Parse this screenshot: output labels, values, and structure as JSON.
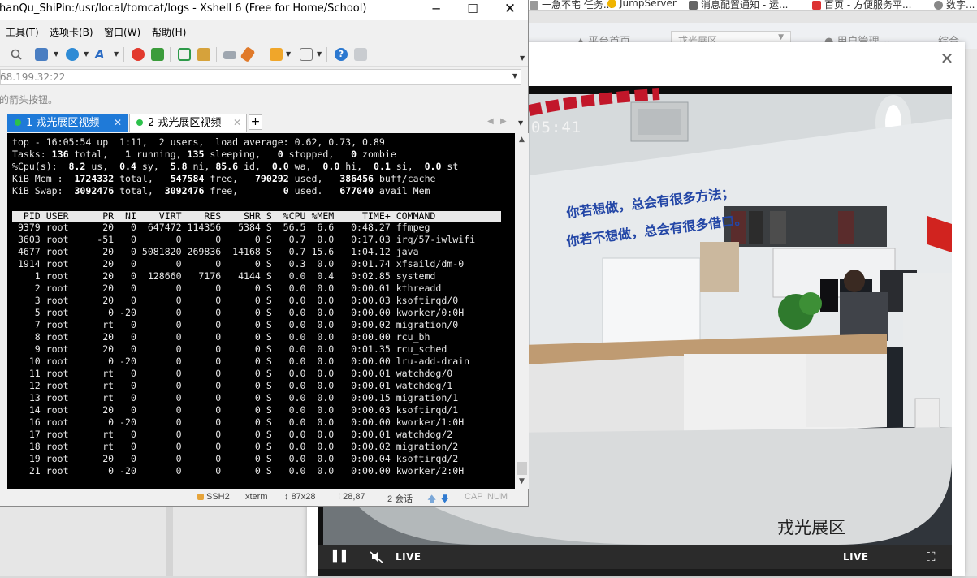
{
  "background": {
    "bookmarks": [
      "一急不宅 任务...",
      "JumpServer",
      "消息配置通知 - 运...",
      "百页 - 方便服务平...",
      "数字..."
    ],
    "nav_items": [
      "平台首页",
      "用户管理",
      "综合"
    ],
    "select_value": "戎光展区"
  },
  "xshell": {
    "title": "hanQu_ShiPin:/usr/local/tomcat/logs - Xshell 6 (Free for Home/School)",
    "menus": [
      "工具(T)",
      "选项卡(B)",
      "窗口(W)",
      "帮助(H)"
    ],
    "address": "68.199.32:22",
    "hint": "的箭头按钮。",
    "tabs": [
      {
        "number": "1",
        "label": "戎光展区视频"
      },
      {
        "number": "2",
        "label": "戎光展区视频"
      }
    ],
    "terminal": {
      "summary": [
        "top - 16:05:54 up  1:11,  2 users,  load average: 0.62, 0.73, 0.89",
        "Tasks: 136 total,   1 running, 135 sleeping,   0 stopped,   0 zombie",
        "%Cpu(s):  8.2 us,  0.4 sy,  5.8 ni, 85.6 id,  0.0 wa,  0.0 hi,  0.1 si,  0.0 st",
        "KiB Mem :  1724332 total,   547584 free,   790292 used,   386456 buff/cache",
        "KiB Swap:  3092476 total,  3092476 free,        0 used.   677040 avail Mem"
      ],
      "header": "  PID USER      PR  NI    VIRT    RES    SHR S  %CPU %MEM     TIME+ COMMAND",
      "processes": [
        " 9379 root      20   0  647472 114356   5384 S  56.5  6.6   0:48.27 ffmpeg",
        " 3603 root     -51   0       0      0      0 S   0.7  0.0   0:17.03 irq/57-iwlwifi",
        " 4677 root      20   0 5081820 269836  14168 S   0.7 15.6   1:04.12 java",
        " 1914 root      20   0       0      0      0 S   0.3  0.0   0:01.74 xfsaild/dm-0",
        "    1 root      20   0  128660   7176   4144 S   0.0  0.4   0:02.85 systemd",
        "    2 root      20   0       0      0      0 S   0.0  0.0   0:00.01 kthreadd",
        "    3 root      20   0       0      0      0 S   0.0  0.0   0:00.03 ksoftirqd/0",
        "    5 root       0 -20       0      0      0 S   0.0  0.0   0:00.00 kworker/0:0H",
        "    7 root      rt   0       0      0      0 S   0.0  0.0   0:00.02 migration/0",
        "    8 root      20   0       0      0      0 S   0.0  0.0   0:00.00 rcu_bh",
        "    9 root      20   0       0      0      0 S   0.0  0.0   0:01.35 rcu_sched",
        "   10 root       0 -20       0      0      0 S   0.0  0.0   0:00.00 lru-add-drain",
        "   11 root      rt   0       0      0      0 S   0.0  0.0   0:00.01 watchdog/0",
        "   12 root      rt   0       0      0      0 S   0.0  0.0   0:00.01 watchdog/1",
        "   13 root      rt   0       0      0      0 S   0.0  0.0   0:00.15 migration/1",
        "   14 root      20   0       0      0      0 S   0.0  0.0   0:00.03 ksoftirqd/1",
        "   16 root       0 -20       0      0      0 S   0.0  0.0   0:00.00 kworker/1:0H",
        "   17 root      rt   0       0      0      0 S   0.0  0.0   0:00.01 watchdog/2",
        "   18 root      rt   0       0      0      0 S   0.0  0.0   0:00.02 migration/2",
        "   19 root      20   0       0      0      0 S   0.0  0.0   0:00.04 ksoftirqd/2",
        "   21 root       0 -20       0      0      0 S   0.0  0.0   0:00.00 kworker/2:0H"
      ]
    },
    "status": {
      "protocol": "SSH2",
      "term_type": "xterm",
      "size": "87x28",
      "cursor": "28,87",
      "sessions": "2 会话",
      "caps": "CAP",
      "num": "NUM"
    }
  },
  "video": {
    "timestamp": "05:41",
    "caption": "戎光展区",
    "slogan_line1": "你若想做，总会有很多方法；",
    "slogan_line2": "你若不想做，总会有很多借口。",
    "live_label_left": "LIVE",
    "live_label_right": "LIVE"
  },
  "colors": {
    "tab_active": "#1f7ad8",
    "tab_dot": "#2cc14b",
    "terminal_bg": "#000000",
    "terminal_fg": "#e8e8e8"
  },
  "icons": [
    "minimize-icon",
    "maximize-icon",
    "close-icon",
    "search-icon",
    "globe-icon",
    "font-icon",
    "help-icon",
    "chat-icon",
    "pause-icon",
    "mute-icon",
    "fullscreen-icon",
    "lock-icon",
    "arrow-up-icon",
    "arrow-down-icon"
  ]
}
